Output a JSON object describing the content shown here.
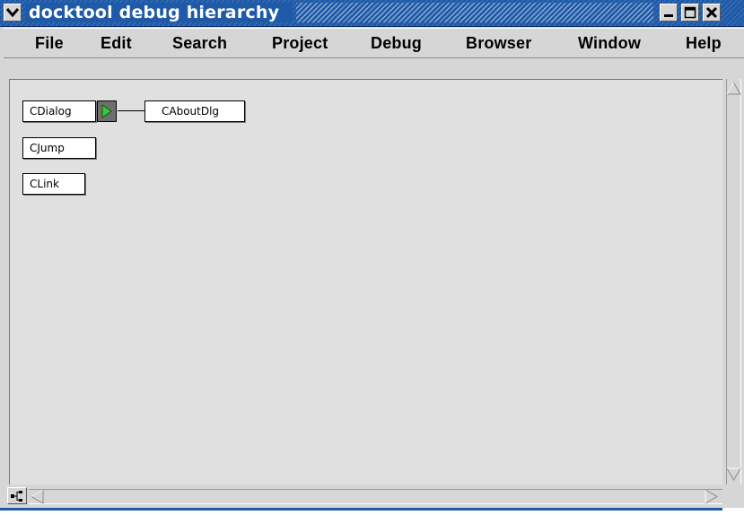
{
  "window": {
    "title": "docktool debug hierarchy",
    "title_bar_color": "#1f5aa8"
  },
  "menubar": {
    "items": [
      "File",
      "Edit",
      "Search",
      "Project",
      "Debug",
      "Browser",
      "Window",
      "Help"
    ]
  },
  "hierarchy": {
    "nodes": [
      {
        "label": "CDialog",
        "has_children": true,
        "children": [
          "CAboutDlg"
        ]
      },
      {
        "label": "CJump",
        "has_children": false
      },
      {
        "label": "CLink",
        "has_children": false
      }
    ],
    "expand_arrow_color": "#3cc83c"
  },
  "icons": {
    "window_menu": "chevron-down-icon",
    "minimize": "minimize-icon",
    "maximize": "maximize-icon",
    "close": "close-icon",
    "tree_toggle": "tree-icon"
  }
}
